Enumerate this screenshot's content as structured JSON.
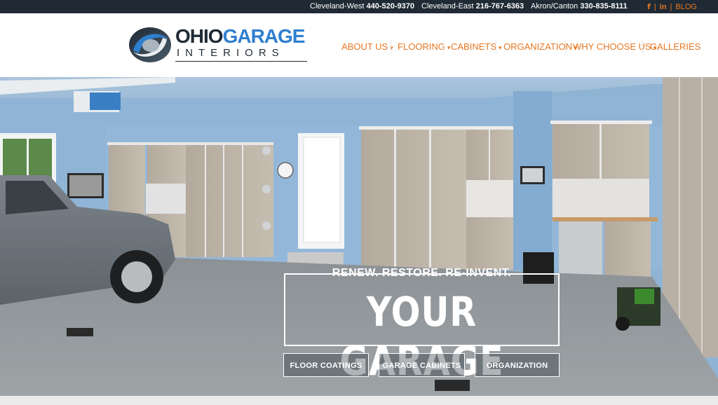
{
  "topbar": {
    "locations": [
      {
        "name": "Cleveland-West",
        "phone": "440-520-9370"
      },
      {
        "name": "Cleveland-East",
        "phone": "216-767-6363"
      },
      {
        "name": "Akron/Canton",
        "phone": "330-835-8111"
      }
    ],
    "social": {
      "facebook": "f",
      "linkedin": "in",
      "blog": "BLOG"
    }
  },
  "logo": {
    "line1_a": "OHIO",
    "line1_b": "GARAGE",
    "line2": "INTERIORS"
  },
  "nav": [
    {
      "label": "ABOUT US",
      "dropdown": true
    },
    {
      "label": "FLOORING",
      "dropdown": true
    },
    {
      "label": "CABINETS",
      "dropdown": true
    },
    {
      "label": "ORGANIZATION",
      "dropdown": true
    },
    {
      "label": "WHY CHOOSE US",
      "dropdown": true
    },
    {
      "label": "GALLERIES",
      "dropdown": false
    }
  ],
  "hero": {
    "tagline": "RENEW. RESTORE. RE-INVENT.",
    "title": "YOUR GARAGE",
    "buttons": [
      "FLOOR COATINGS",
      "GARAGE CABINETS",
      "ORGANIZATION"
    ]
  },
  "colors": {
    "accent": "#e87722",
    "dark": "#1f2a35",
    "brand_blue": "#2f7fd0"
  }
}
